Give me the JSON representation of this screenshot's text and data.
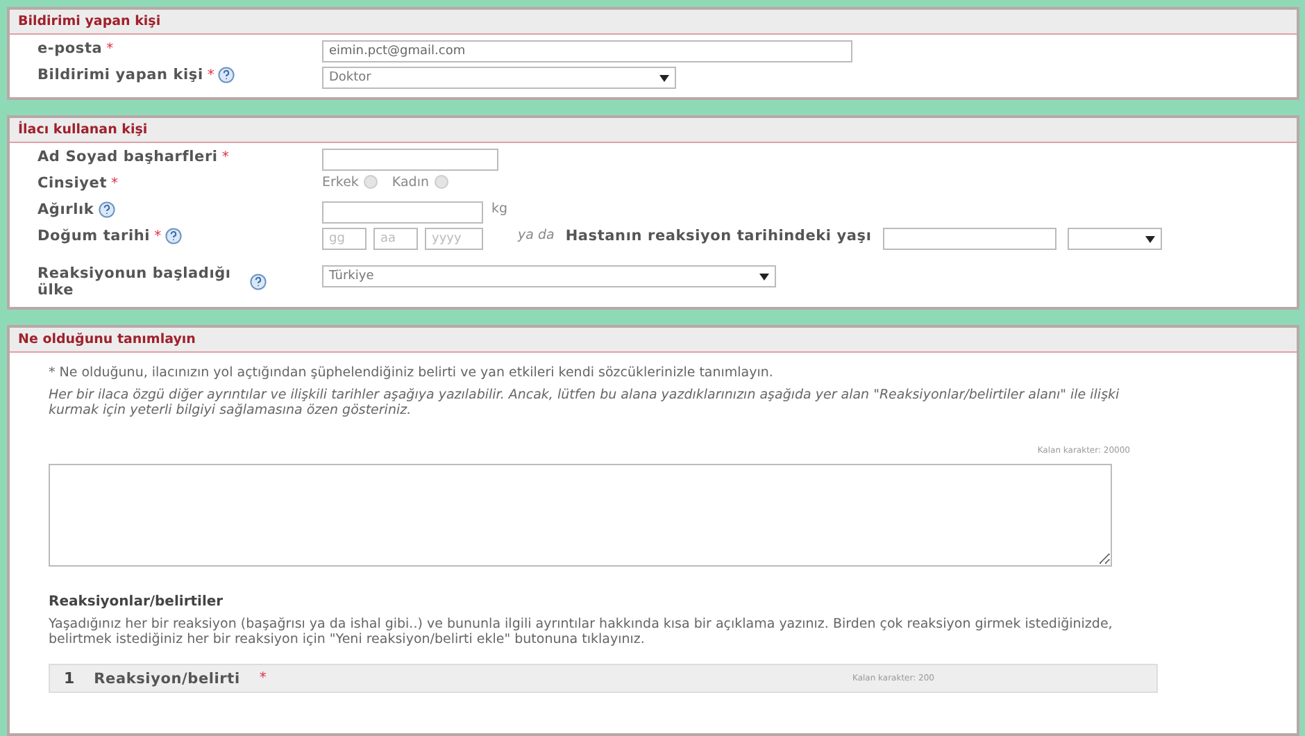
{
  "reporter": {
    "title": "Bildirimi yapan kişi",
    "email": {
      "label": "e-posta",
      "required_mark": "*",
      "value": "eimin.pct@gmail.com"
    },
    "role": {
      "label": "Bildirimi yapan kişi",
      "required_mark": "*",
      "help": true,
      "value": "Doktor"
    }
  },
  "patient": {
    "title": "İlacı kullanan kişi",
    "initials": {
      "label": "Ad Soyad başharfleri",
      "required_mark": "*"
    },
    "gender": {
      "label": "Cinsiyet",
      "required_mark": "*",
      "options": [
        {
          "label": "Erkek",
          "selected": false
        },
        {
          "label": "Kadın",
          "selected": false
        }
      ]
    },
    "weight": {
      "label": "Ağırlık",
      "help": true,
      "unit": "kg"
    },
    "birth": {
      "label": "Doğum tarihi",
      "required_mark": "*",
      "help": true,
      "placeholders": [
        "gg",
        "aa",
        "yyyy"
      ],
      "or": "ya da",
      "age_label": "Hastanın reaksiyon tarihindeki yaşı"
    },
    "country": {
      "label": "Reaksiyonun başladığı ülke",
      "help": true,
      "value": "Türkiye"
    }
  },
  "description": {
    "title": "Ne olduğunu tanımlayın",
    "intro": "* Ne olduğunu, ilacınızın yol açtığından şüphelendiğiniz belirti ve yan etkileri kendi sözcüklerinizle tanımlayın.",
    "note": "Her bir ilaca özgü diğer ayrıntılar ve ilişkili tarihler aşağıya yazılabilir. Ancak, lütfen bu alana yazdıklarınızın aşağıda yer alan \"Reaksiyonlar/belirtiler alanı\" ile ilişki kurmak için yeterli bilgiyi sağlamasına özen gösteriniz.",
    "counter": "Kalan karakter: 20000",
    "reactions_title": "Reaksiyonlar/belirtiler",
    "reactions_text": "Yaşadığınız her bir reaksiyon (başağrısı ya da ishal gibi..) ve bununla ilgili ayrıntılar hakkında kısa bir açıklama yazınız. Birden çok reaksiyon girmek istediğinizde, belirtmek istediğiniz her bir reaksiyon için \"Yeni reaksiyon/belirti ekle\" butonuna tıklayınız.",
    "reaction": {
      "number": "1",
      "label": "Reaksiyon/belirti",
      "required_mark": "*",
      "counter": "Kalan karakter: 200"
    }
  }
}
